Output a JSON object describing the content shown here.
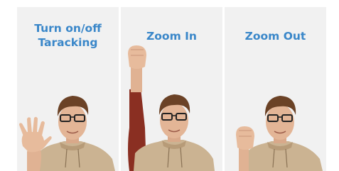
{
  "colors": {
    "label": "#3a87c9",
    "panel_bg": "#f1f1f1"
  },
  "gestures": [
    {
      "label_line1": "Turn on/off",
      "label_line2": "Taracking",
      "icon": "open-palm-icon"
    },
    {
      "label_line1": "Zoom In",
      "icon": "raised-fist-icon"
    },
    {
      "label_line1": "Zoom Out",
      "icon": "raised-fist-icon"
    }
  ]
}
